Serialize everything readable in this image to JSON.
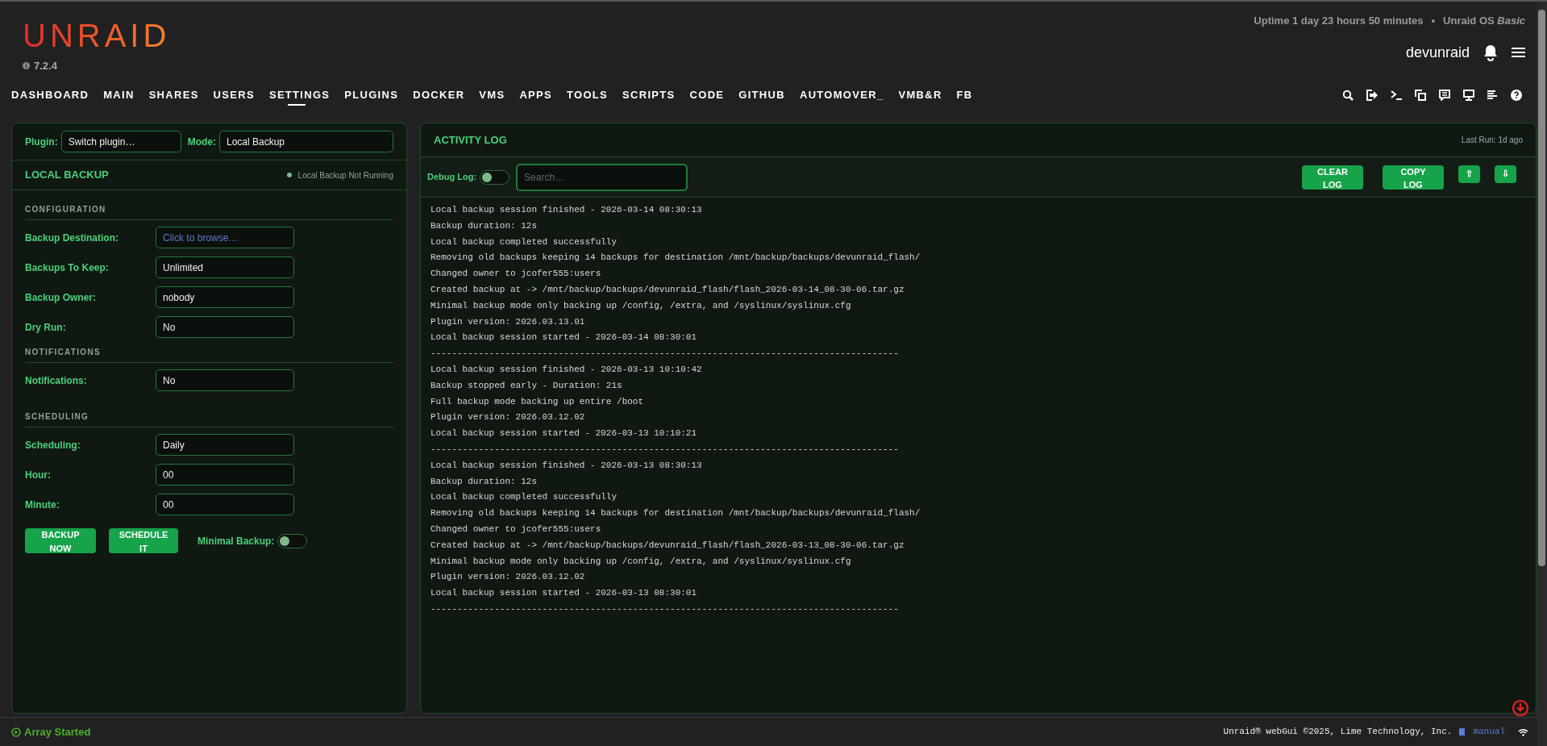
{
  "header": {
    "logo": "UNRAID",
    "version": "7.2.4",
    "uptime": "Uptime 1 day 23 hours 50 minutes",
    "separator": "•",
    "os_label": "Unraid OS *Basic*",
    "hostname": "devunraid"
  },
  "nav": {
    "tabs": [
      {
        "label": "DASHBOARD",
        "selected": false
      },
      {
        "label": "MAIN",
        "selected": false
      },
      {
        "label": "SHARES",
        "selected": false
      },
      {
        "label": "USERS",
        "selected": false
      },
      {
        "label": "SETTINGS",
        "selected": true
      },
      {
        "label": "PLUGINS",
        "selected": false
      },
      {
        "label": "DOCKER",
        "selected": false
      },
      {
        "label": "VMS",
        "selected": false
      },
      {
        "label": "APPS",
        "selected": false
      },
      {
        "label": "TOOLS",
        "selected": false
      },
      {
        "label": "SCRIPTS",
        "selected": false
      },
      {
        "label": "CODE",
        "selected": false
      },
      {
        "label": "GITHUB",
        "selected": false
      },
      {
        "label": "AUTOMOVER_",
        "selected": false
      },
      {
        "label": "VMB&R",
        "selected": false
      },
      {
        "label": "FB",
        "selected": false
      }
    ]
  },
  "plugin_bar": {
    "plugin_label": "Plugin:",
    "plugin_value": "Switch plugin…",
    "mode_label": "Mode:",
    "mode_value": "Local Backup"
  },
  "local_backup": {
    "title": "LOCAL BACKUP",
    "status": "Local Backup Not Running",
    "running": false,
    "sections": [
      {
        "heading": "CONFIGURATION",
        "fields": [
          {
            "label": "Backup Destination:",
            "placeholder": "Click to browse…"
          },
          {
            "label": "Backups To Keep:",
            "value": "Unlimited"
          },
          {
            "label": "Backup Owner:",
            "value": "nobody"
          },
          {
            "label": "Dry Run:",
            "value": "No"
          }
        ]
      },
      {
        "heading": "NOTIFICATIONS",
        "fields": [
          {
            "label": "Notifications:",
            "value": "No"
          }
        ]
      },
      {
        "heading": "SCHEDULING",
        "fields": [
          {
            "label": "Scheduling:",
            "value": "Daily"
          },
          {
            "label": "Hour:",
            "value": "00"
          },
          {
            "label": "Minute:",
            "value": "00"
          }
        ]
      }
    ],
    "buttons": [
      "BACKUP NOW",
      "SCHEDULE IT"
    ],
    "minimal_backup": {
      "label": "Minimal Backup:",
      "on": false
    }
  },
  "activity_log": {
    "title": "ACTIVITY LOG",
    "last_run": "Last Run: 1d ago",
    "debug_log": {
      "label": "Debug Log:",
      "on": false
    },
    "search": {
      "placeholder": "Search…"
    },
    "buttons": [
      {
        "kind": "text",
        "label": "CLEAR LOG"
      },
      {
        "kind": "text",
        "label": "COPY LOG"
      },
      {
        "kind": "icon",
        "label": "⇧"
      },
      {
        "kind": "icon",
        "label": "⇩"
      }
    ],
    "lines": [
      "Local backup session finished - 2026-03-14 08:30:13",
      "Backup duration: 12s",
      "Local backup completed successfully",
      "Removing old backups keeping 14 backups for destination /mnt/backup/backups/devunraid_flash/",
      "Changed owner to jcofer555:users",
      "Created backup at -> /mnt/backup/backups/devunraid_flash/flash_2026-03-14_08-30-06.tar.gz",
      "Minimal backup mode only backing up /config, /extra, and /syslinux/syslinux.cfg",
      "Plugin version: 2026.03.13.01",
      "Local backup session started - 2026-03-14 08:30:01",
      "----------------------------------------------------------------------------------------",
      "Local backup session finished - 2026-03-13 10:10:42",
      "Backup stopped early - Duration: 21s",
      "Full backup mode backing up entire /boot",
      "Plugin version: 2026.03.12.02",
      "Local backup session started - 2026-03-13 10:10:21",
      "----------------------------------------------------------------------------------------",
      "Local backup session finished - 2026-03-13 08:30:13",
      "Backup duration: 12s",
      "Local backup completed successfully",
      "Removing old backups keeping 14 backups for destination /mnt/backup/backups/devunraid_flash/",
      "Changed owner to jcofer555:users",
      "Created backup at -> /mnt/backup/backups/devunraid_flash/flash_2026-03-13_08-30-06.tar.gz",
      "Minimal backup mode only backing up /config, /extra, and /syslinux/syslinux.cfg",
      "Plugin version: 2026.03.12.02",
      "Local backup session started - 2026-03-13 08:30:01",
      "----------------------------------------------------------------------------------------"
    ]
  },
  "status_bar": {
    "array_status": "Array Started",
    "copyright": "Unraid® webGui ©2025, Lime Technology, Inc.",
    "manual": "manual"
  }
}
